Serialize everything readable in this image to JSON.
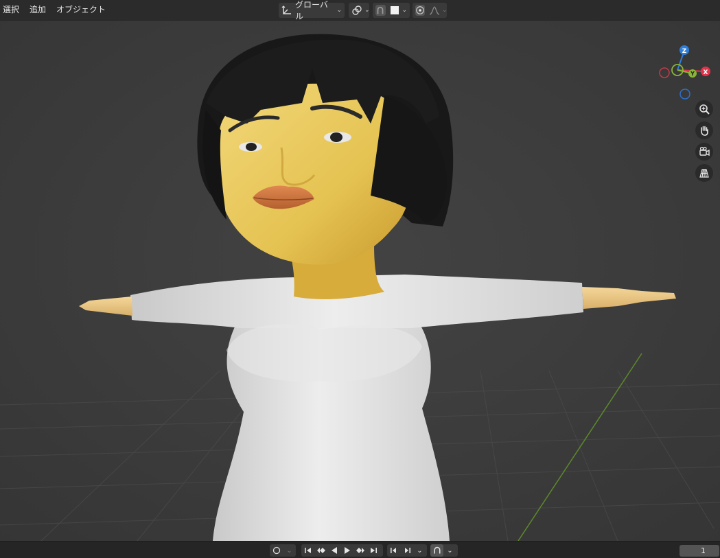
{
  "header": {
    "menu": [
      "選択",
      "追加",
      "オブジェクト"
    ],
    "transform_orientation": "グローバル"
  },
  "gizmo": {
    "z_label": "Z",
    "y_label": "Y",
    "x_label": "X",
    "colors": {
      "x": "#e0344c",
      "y": "#8ab53a",
      "z": "#2f7ed8"
    }
  },
  "nav_icons": [
    "zoom-icon",
    "hand-pan-icon",
    "camera-icon",
    "perspective-grid-icon"
  ],
  "footer": {
    "current_frame": "1"
  }
}
